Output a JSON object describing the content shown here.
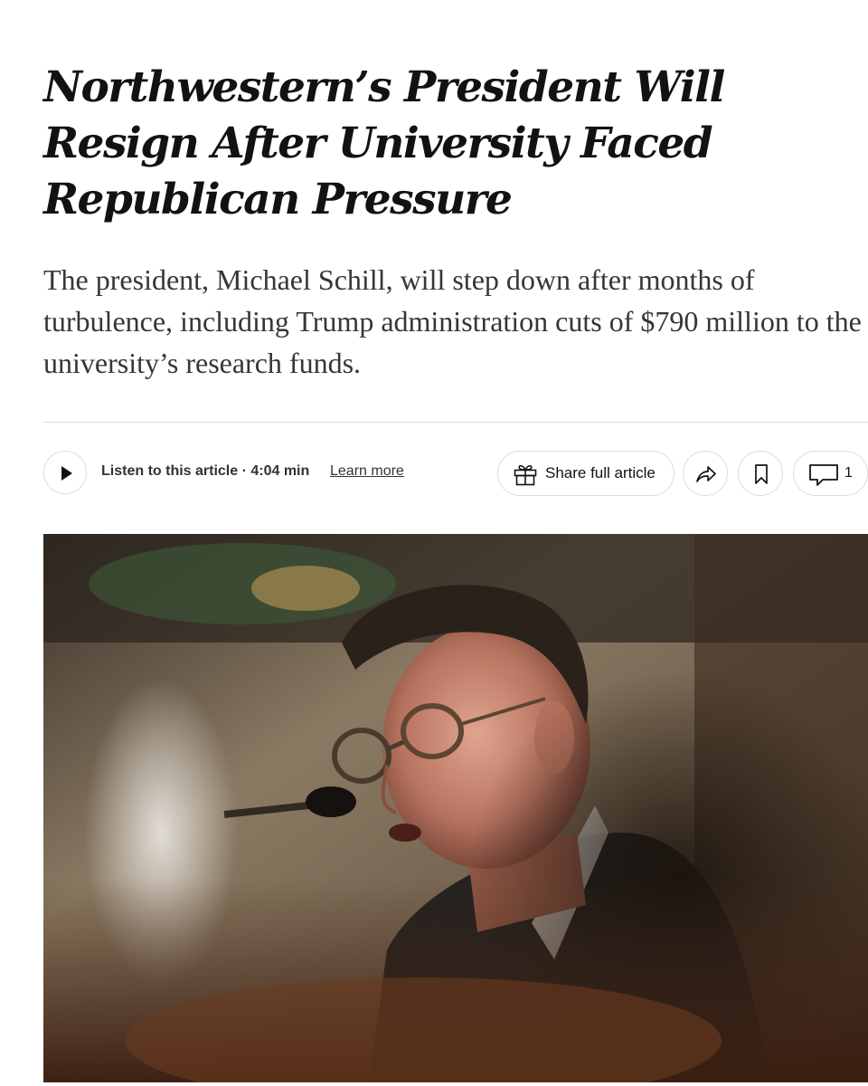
{
  "article": {
    "headline": "Northwestern’s President Will Resign After University Faced Republican Pressure",
    "summary": "The president, Michael Schill, will step down after months of turbulence, including Trump administration cuts of $790 million to the university’s research funds."
  },
  "toolbar": {
    "listen_label": "Listen to this article · 4:04 min",
    "learn_more": "Learn more",
    "share_full_article": "Share full article",
    "comment_count": "1",
    "icons": {
      "play": "play-icon",
      "gift": "gift-icon",
      "share": "share-arrow-icon",
      "save": "bookmark-icon",
      "comments": "comment-bubble-icon"
    }
  },
  "photo": {
    "subject": "Man with glasses speaking at microphone"
  },
  "colors": {
    "text": "#121212",
    "summary_text": "#363636",
    "border": "#dcdcdc"
  }
}
